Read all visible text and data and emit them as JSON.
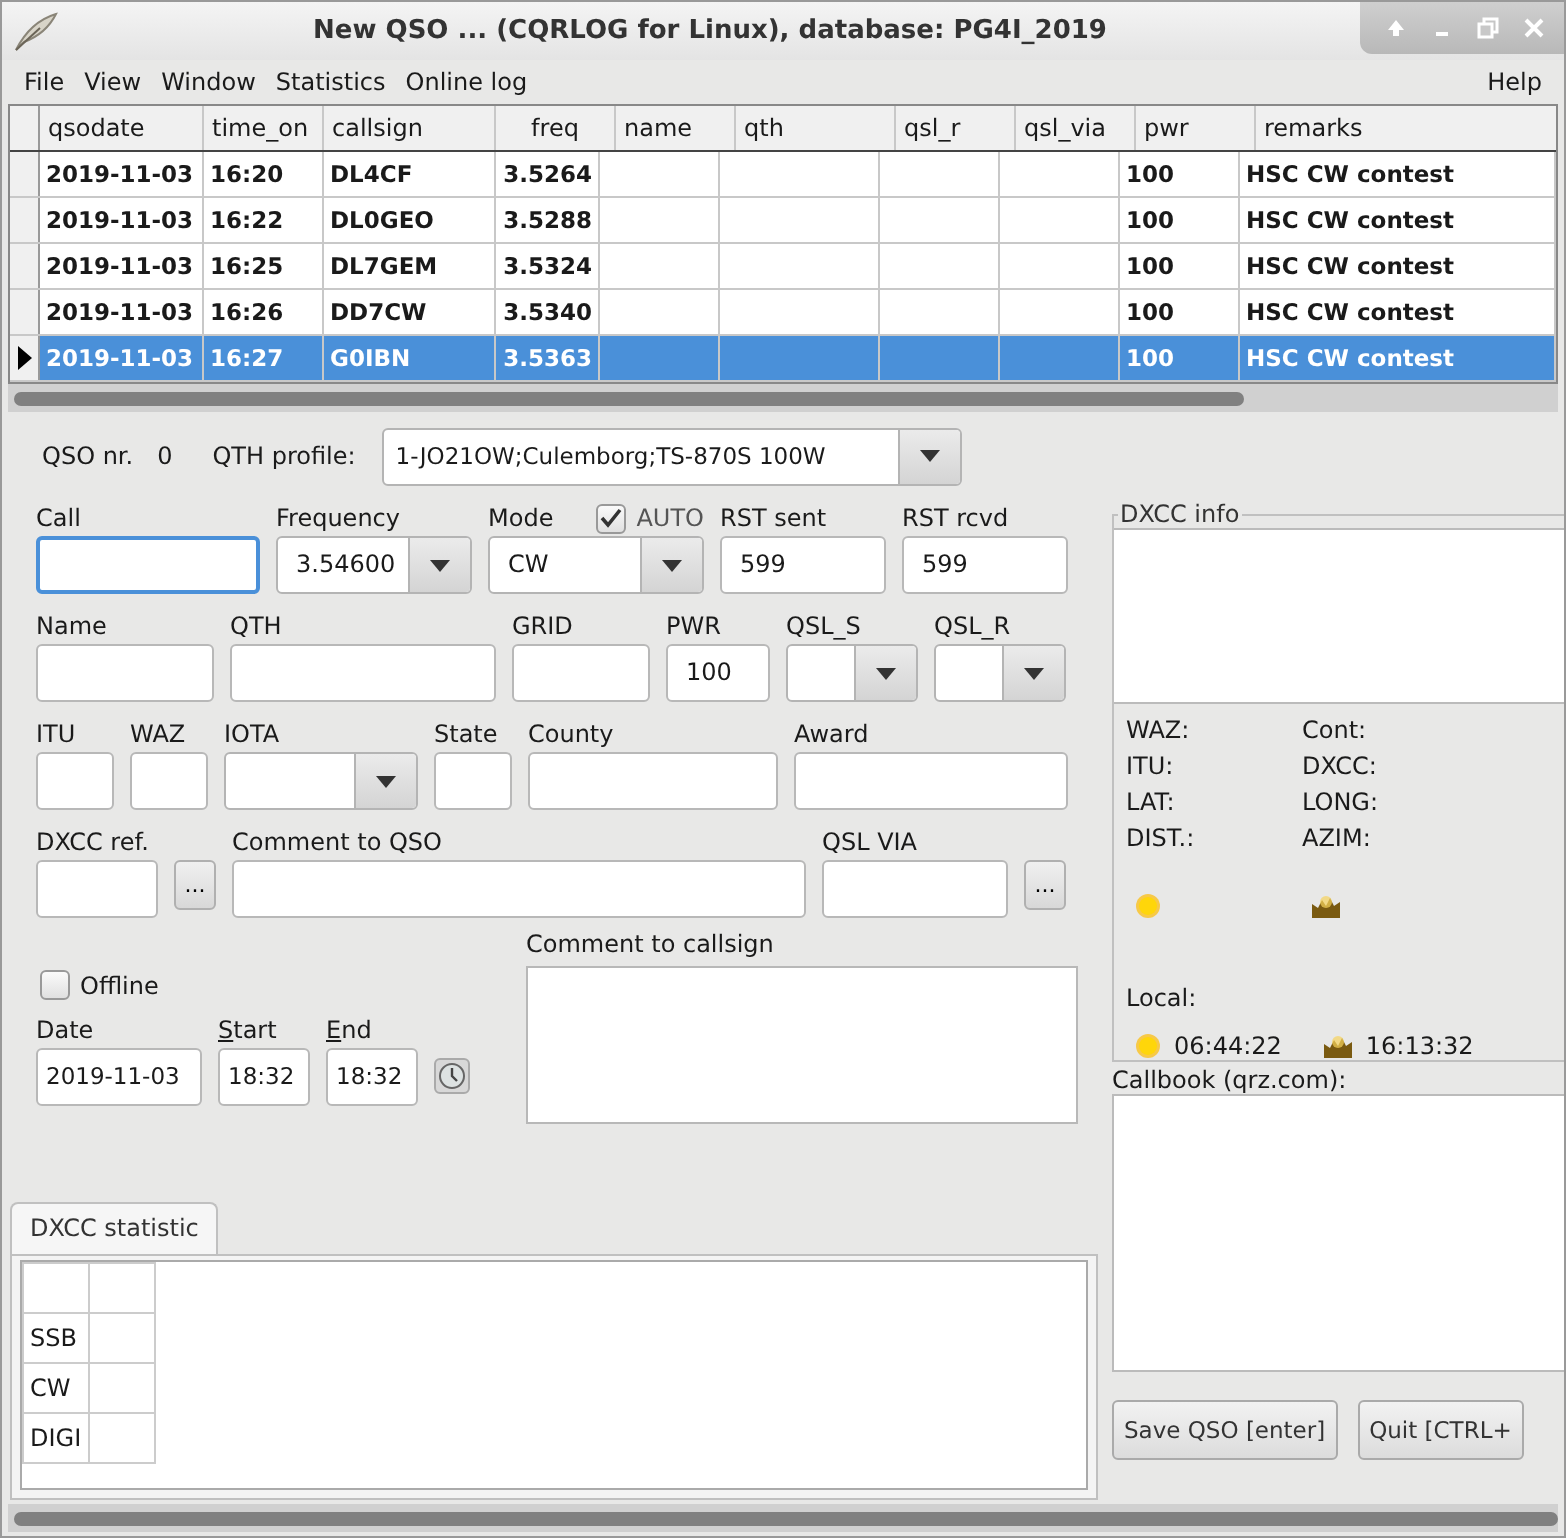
{
  "window": {
    "title": "New QSO ... (CQRLOG for Linux), database: PG4I_2019"
  },
  "menu": {
    "items": [
      "File",
      "View",
      "Window",
      "Statistics",
      "Online log"
    ],
    "right": "Help"
  },
  "table": {
    "columns": [
      {
        "label": "qsodate",
        "numeric": false
      },
      {
        "label": "time_on",
        "numeric": false
      },
      {
        "label": "callsign",
        "numeric": false
      },
      {
        "label": "freq",
        "numeric": true
      },
      {
        "label": "name",
        "numeric": false
      },
      {
        "label": "qth",
        "numeric": false
      },
      {
        "label": "qsl_r",
        "numeric": false
      },
      {
        "label": "qsl_via",
        "numeric": false
      },
      {
        "label": "pwr",
        "numeric": false
      },
      {
        "label": "remarks",
        "numeric": false
      }
    ],
    "rows": [
      {
        "selected": false,
        "cells": [
          "2019-11-03",
          "16:20",
          "DL4CF",
          "3.5264",
          null,
          null,
          null,
          null,
          "100",
          "HSC CW contest"
        ]
      },
      {
        "selected": false,
        "cells": [
          "2019-11-03",
          "16:22",
          "DL0GEO",
          "3.5288",
          null,
          null,
          null,
          null,
          "100",
          "HSC CW contest"
        ]
      },
      {
        "selected": false,
        "cells": [
          "2019-11-03",
          "16:25",
          "DL7GEM",
          "3.5324",
          null,
          null,
          null,
          null,
          "100",
          "HSC CW contest"
        ]
      },
      {
        "selected": false,
        "cells": [
          "2019-11-03",
          "16:26",
          "DD7CW",
          "3.5340",
          null,
          null,
          null,
          null,
          "100",
          "HSC CW contest"
        ]
      },
      {
        "selected": true,
        "cells": [
          "2019-11-03",
          "16:27",
          "G0IBN",
          "3.5363",
          null,
          null,
          null,
          null,
          "100",
          "HSC CW contest"
        ]
      }
    ]
  },
  "qso": {
    "nr_label": "QSO nr.",
    "nr": "0",
    "profile_label": "QTH profile:",
    "profile": "1-JO21OW;Culemborg;TS-870S 100W"
  },
  "fields": [
    [
      {
        "kind": "text",
        "label": "Call",
        "focused": true
      },
      {
        "kind": "combo",
        "label": "Frequency",
        "value": "3.54600"
      },
      {
        "kind": "combo",
        "label": "Mode",
        "value": "CW",
        "checkbox": {
          "label": "AUTO",
          "checked": true
        }
      },
      {
        "kind": "text",
        "label": "RST sent",
        "value": "599"
      },
      {
        "kind": "text",
        "label": "RST rcvd",
        "value": "599"
      }
    ],
    [
      {
        "kind": "text",
        "label": "Name"
      },
      {
        "kind": "text",
        "label": "QTH"
      },
      {
        "kind": "text",
        "label": "GRID"
      },
      {
        "kind": "text",
        "label": "PWR",
        "value": "100"
      },
      {
        "kind": "combo",
        "label": "QSL_S"
      },
      {
        "kind": "combo",
        "label": "QSL_R"
      }
    ],
    [
      {
        "kind": "text",
        "label": "ITU"
      },
      {
        "kind": "text",
        "label": "WAZ"
      },
      {
        "kind": "combo",
        "label": "IOTA"
      },
      {
        "kind": "text",
        "label": "State"
      },
      {
        "kind": "text",
        "label": "County"
      },
      {
        "kind": "text",
        "label": "Award"
      }
    ],
    [
      {
        "kind": "text",
        "label": "DXCC ref."
      },
      {
        "kind": "button",
        "value": "..."
      },
      {
        "kind": "text",
        "label": "Comment to QSO"
      },
      {
        "kind": "text",
        "label": "QSL VIA"
      },
      {
        "kind": "button",
        "value": "..."
      }
    ]
  ],
  "offline": {
    "label": "Offline",
    "checked": false
  },
  "times": [
    {
      "kind": "text",
      "label": "Date",
      "value": "2019-11-03",
      "accelerator": false
    },
    {
      "kind": "text",
      "label": "Start",
      "value": "18:32",
      "accelerator": true
    },
    {
      "kind": "text",
      "label": "End",
      "value": "18:32",
      "accelerator": true
    }
  ],
  "comment_to_callsign": {
    "label": "Comment to callsign"
  },
  "stat_tab": {
    "label": "DXCC statistic",
    "selected": true,
    "rows": [
      "SSB",
      "CW",
      "DIGI"
    ]
  },
  "dxcc_info": {
    "title": "DXCC info",
    "labels": [
      "WAZ:",
      "Cont:",
      "ITU:",
      "DXCC:",
      "LAT:",
      "LONG:",
      "DIST.:",
      "AZIM:"
    ],
    "local_label": "Local:",
    "sunrise": "06:44:22",
    "sunset": "16:13:32",
    "callbook_label": "Callbook (qrz.com):"
  },
  "buttons": [
    "Save QSO [enter]",
    "Quit [CTRL+"
  ]
}
